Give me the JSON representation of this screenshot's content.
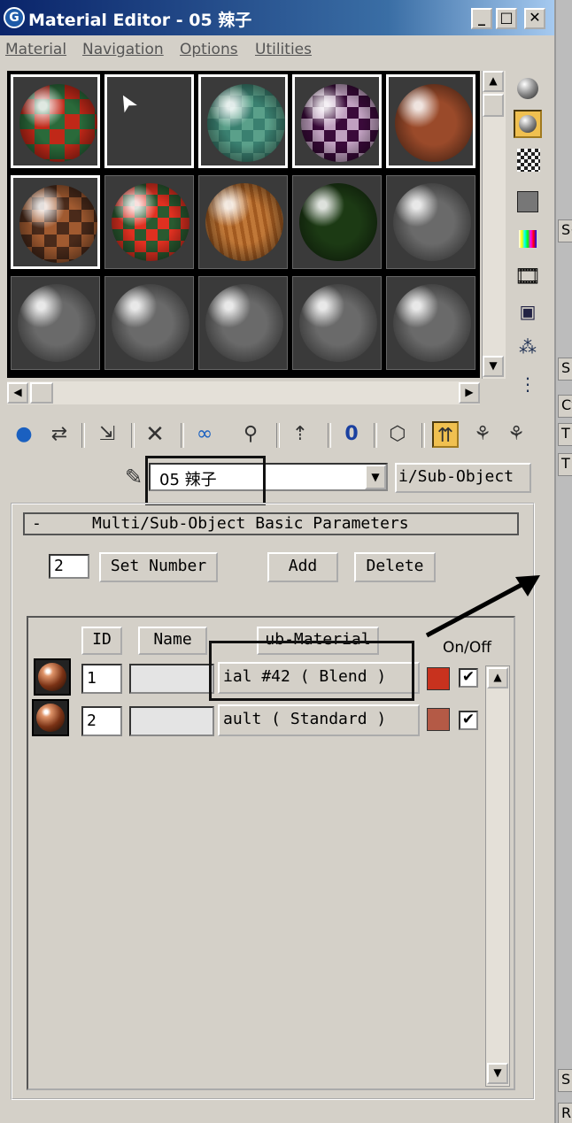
{
  "window": {
    "title": "Material Editor - 05 辣子",
    "minimize": "_",
    "maximize": "□",
    "close": "✕"
  },
  "menu": [
    "Material",
    "Navigation",
    "Options",
    "Utilities"
  ],
  "slots": [
    {
      "style": "checker-red-green",
      "active": true
    },
    {
      "style": "empty",
      "active": true
    },
    {
      "style": "checker-teal",
      "active": true
    },
    {
      "style": "checker-purple",
      "active": true
    },
    {
      "style": "copper",
      "active": true
    },
    {
      "style": "checker-brown",
      "active": true
    },
    {
      "style": "checker-red-green-bright",
      "active": false
    },
    {
      "style": "wood",
      "active": false
    },
    {
      "style": "dark-green",
      "active": false
    },
    {
      "style": "grey",
      "active": false
    },
    {
      "style": "grey",
      "active": false
    },
    {
      "style": "grey",
      "active": false
    },
    {
      "style": "grey",
      "active": false
    },
    {
      "style": "grey",
      "active": false
    },
    {
      "style": "grey",
      "active": false
    }
  ],
  "side_tools": [
    "sample-type-icon",
    "backlight-icon",
    "background-icon",
    "uv-tiling-icon",
    "video-color-check-icon",
    "make-preview-icon",
    "options-icon",
    "select-by-material-icon",
    "material-map-navigator-icon"
  ],
  "bottom_tools": [
    "get-material-icon",
    "put-to-scene-icon",
    "assign-to-selection-icon",
    "reset-map-icon",
    "make-unique-icon",
    "put-to-library-icon",
    "material-effects-channel-icon",
    "show-map-in-viewport-icon",
    "show-end-result-icon",
    "go-to-parent-icon",
    "go-forward-to-sibling-icon"
  ],
  "material_name": "05 辣子",
  "material_type": "i/Sub-Object",
  "rollout_title": "Multi/Sub-Object Basic Parameters",
  "rollout_toggle": "-",
  "set_number": {
    "value": "2",
    "label": "Set Number"
  },
  "add_label": "Add",
  "delete_label": "Delete",
  "columns": {
    "id": "ID",
    "name": "Name",
    "sub_material": "ub-Material",
    "on_off": "On/Off"
  },
  "rows": [
    {
      "id": "1",
      "name": "",
      "sub_material": "ial #42   ( Blend )",
      "color": "#c8321e",
      "on": "✔"
    },
    {
      "id": "2",
      "name": "",
      "sub_material": "ault   ( Standard )",
      "color": "#b45a46",
      "on": "✔"
    }
  ],
  "right_strip": [
    "S+",
    "S",
    "Cy",
    "T",
    "T",
    "S",
    "R"
  ]
}
